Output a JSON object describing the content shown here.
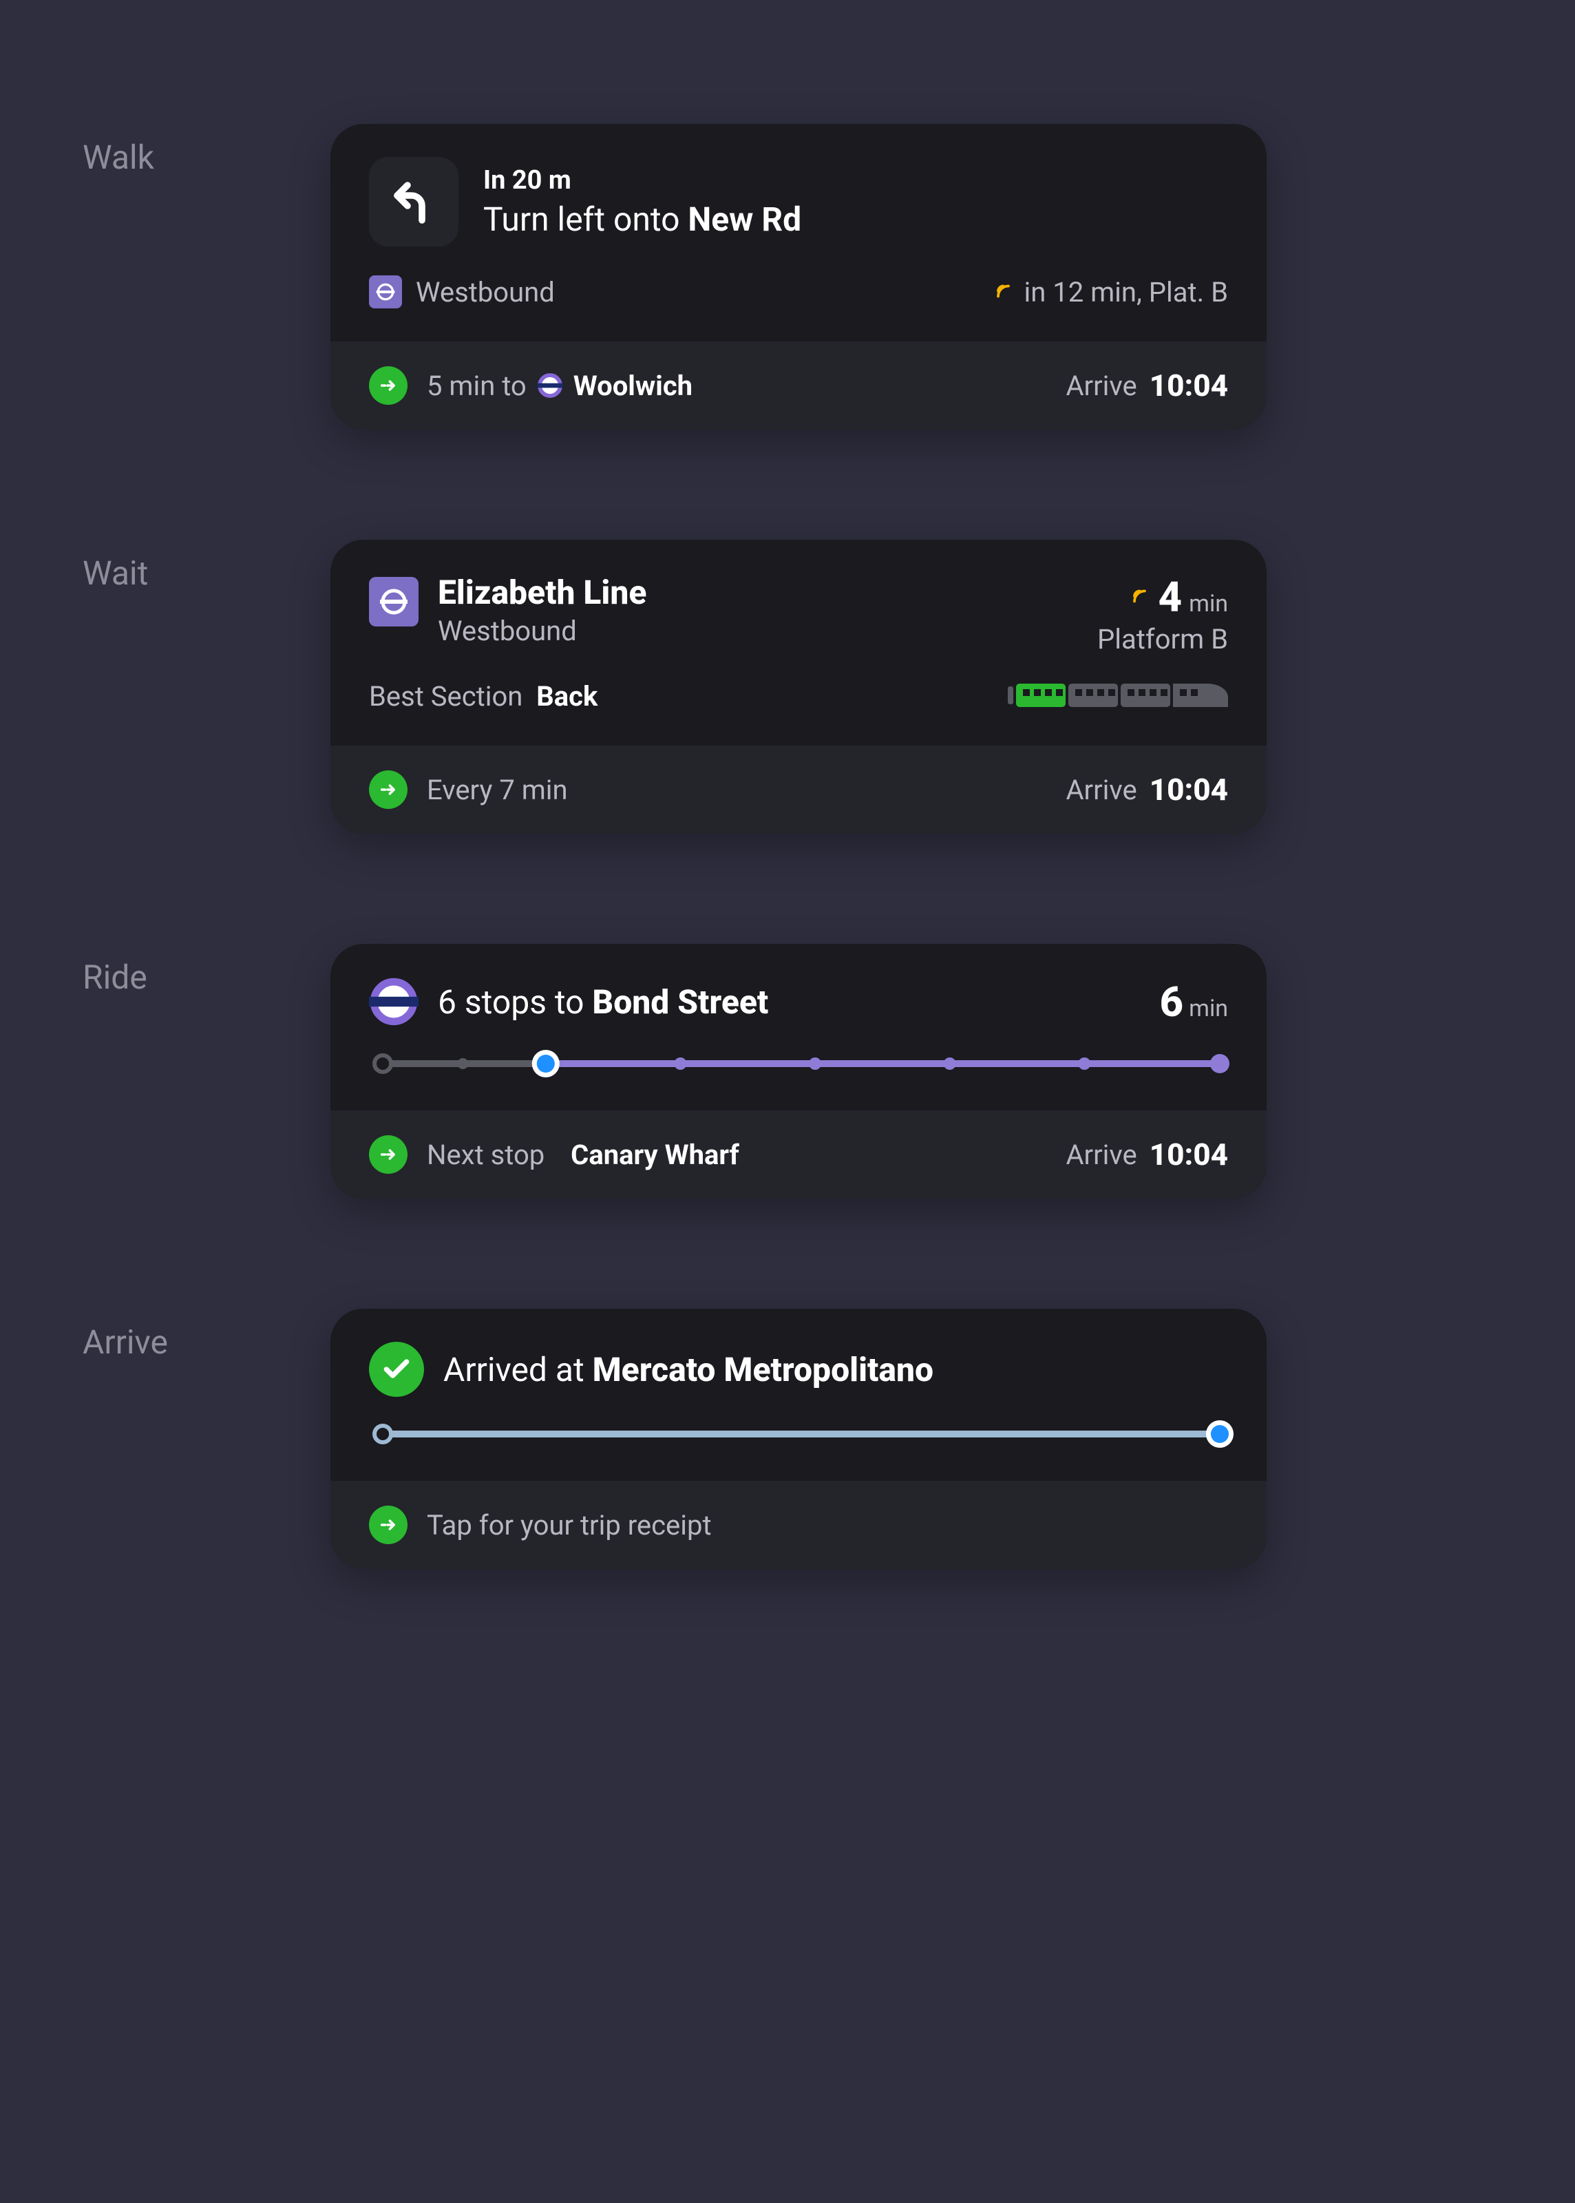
{
  "labels": {
    "walk": "Walk",
    "wait": "Wait",
    "ride": "Ride",
    "arrive": "Arrive"
  },
  "walk": {
    "distance": "In 20 m",
    "action_prefix": "Turn left onto ",
    "action_bold": "New Rd",
    "direction": "Westbound",
    "next_time": "in 12 min, Plat. B",
    "bottom_prefix": "5 min to",
    "bottom_dest": "Woolwich",
    "arrive_label": "Arrive",
    "arrive_time": "10:04"
  },
  "wait": {
    "line": "Elizabeth Line",
    "direction": "Westbound",
    "eta_num": "4",
    "eta_unit": "min",
    "platform": "Platform B",
    "best_label": "Best Section",
    "best_value": "Back",
    "frequency": "Every 7 min",
    "arrive_label": "Arrive",
    "arrive_time": "10:04"
  },
  "ride": {
    "stops_prefix": "6 stops to ",
    "destination": "Bond Street",
    "eta_num": "6",
    "eta_unit": "min",
    "total_stops": 6,
    "current_stop": 2,
    "next_label": "Next stop",
    "next_stop": "Canary Wharf",
    "arrive_label": "Arrive",
    "arrive_time": "10:04"
  },
  "arrive": {
    "prefix": "Arrived at ",
    "place": "Mercato Metropolitano",
    "receipt": "Tap for your trip receipt"
  },
  "colors": {
    "green": "#2ab930",
    "purple": "#7c6fc5",
    "elizabeth": "#8568d8",
    "live": "#f5b300",
    "blue": "#1e90ff",
    "lightblue": "#9db9d3",
    "grey": "#5a5a63"
  }
}
